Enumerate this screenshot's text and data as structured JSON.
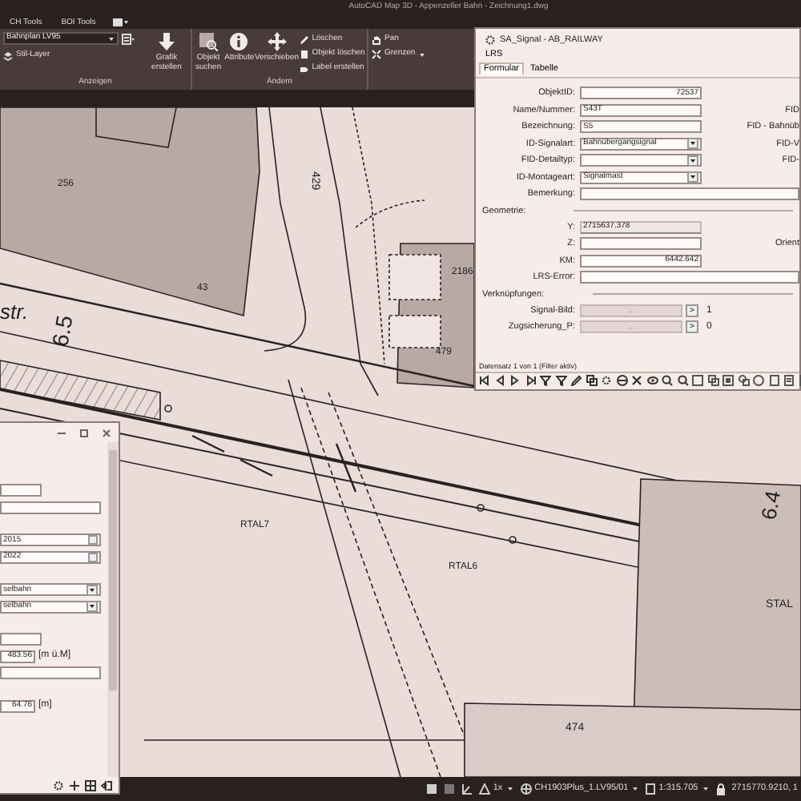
{
  "app_title": "AutoCAD Map 3D - Appenzeller Bahn - Zeichnung1.dwg",
  "ribbon_tabs": [
    {
      "label": "CH Tools",
      "selected": false
    },
    {
      "label": "BOI Tools",
      "selected": false
    }
  ],
  "ribbon": {
    "layer_select": "Bahnplan LV95",
    "style_layer": "Stil-Layer",
    "large_buttons": [
      "Grafik erstellen",
      "Objekt suchen",
      "Attribute",
      "Verschieben"
    ],
    "small_buttons": [
      "Löschen",
      "Objekt löschen",
      "Label erstellen"
    ],
    "nav_buttons": [
      "Pan",
      "Grenzen"
    ],
    "group_labels": [
      "Anzeigen",
      "Ändern"
    ]
  },
  "map_labels": [
    "256",
    "43",
    "429",
    "2186",
    "479",
    "str.",
    "6.5",
    "RTAL7",
    "RTAL6",
    "474",
    "6.4",
    "STAL"
  ],
  "form_window": {
    "title": "SA_Signal - AB_RAILWAY",
    "menu": [
      "LRS"
    ],
    "tabs": [
      {
        "label": "Formular",
        "selected": true
      },
      {
        "label": "Tabelle",
        "selected": false
      }
    ],
    "fields": [
      {
        "label": "ObjektID:",
        "kind": "number",
        "value": "72537"
      },
      {
        "label": "Name/Nummer:",
        "kind": "text",
        "value": "S43T",
        "side_label": "FID"
      },
      {
        "label": "Bezeichnung:",
        "kind": "text",
        "value": "S5",
        "side_label": "FID - Bahnüb"
      },
      {
        "label": "ID-Signalart:",
        "kind": "select",
        "value": "Bahnübergangsignal",
        "side_label": "FID-V"
      },
      {
        "label": "FID-Detailtyp:",
        "kind": "select",
        "side_label": "FID-"
      },
      {
        "label": "ID-Montageart:",
        "kind": "select",
        "value": "Signalmast"
      },
      {
        "label": "Bemerkung:",
        "kind": "wide"
      }
    ],
    "geometry": {
      "title": "Geometrie:",
      "fields": [
        {
          "label": "Y:",
          "kind": "readonly",
          "value": "2715637.378"
        },
        {
          "label": "Z:",
          "kind": "text",
          "side_label": "Orient"
        },
        {
          "label": "KM:",
          "kind": "number",
          "value": "6442.642"
        },
        {
          "label": "LRS-Error:",
          "kind": "wide"
        }
      ]
    },
    "links": {
      "title": "Verknüpfungen:",
      "rows": [
        {
          "label": "Signal-Bild:",
          "button": "...",
          "arrow": ">",
          "count": "1"
        },
        {
          "label": "Zugsicherung_P:",
          "button": "...",
          "arrow": ">",
          "count": "0"
        }
      ]
    },
    "record_status": "Datensatz 1 von 1 (Filter aktiv)"
  },
  "left_window": {
    "groups": [
      [
        {
          "kind": "short"
        },
        {
          "kind": "wide"
        }
      ],
      [
        {
          "kind": "date",
          "value": "2015"
        },
        {
          "kind": "date",
          "value": "2022"
        }
      ],
      [
        {
          "kind": "select",
          "value": "selbahn"
        },
        {
          "kind": "select",
          "value": "selbahn"
        }
      ],
      [
        {
          "kind": "short"
        },
        {
          "kind": "number",
          "value": "483.56",
          "unit": "[m ü.M]"
        },
        {
          "kind": "wide"
        }
      ],
      [
        {
          "kind": "number",
          "value": "64.76",
          "unit": "[m]"
        }
      ]
    ]
  },
  "status_bar": {
    "zoom": "1x",
    "coordinate_system": "CH1903Plus_1.LV95/01",
    "scale": "1:315.705",
    "coordinates": "2715770.9210, 1"
  }
}
